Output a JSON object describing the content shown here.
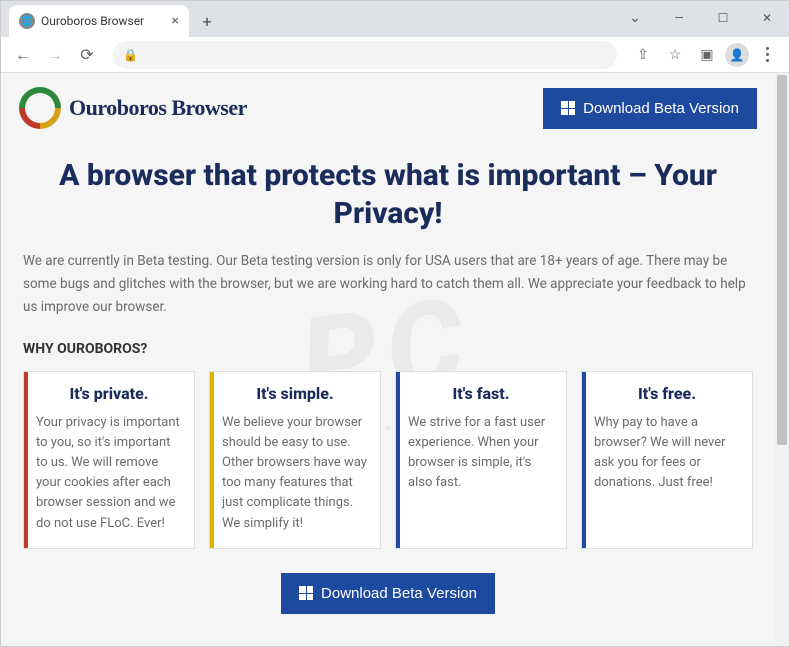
{
  "chrome": {
    "tab_title": "Ouroboros Browser",
    "tab_close": "×",
    "new_tab": "+",
    "win_chevron": "⌄",
    "win_minimize": "—",
    "win_maximize": "☐",
    "win_close": "✕",
    "nav_back": "←",
    "nav_forward": "→",
    "nav_reload": "⟳",
    "lock": "🔒",
    "share": "⇪",
    "star": "☆",
    "reader": "▣"
  },
  "header": {
    "brand": "Ouroboros Browser",
    "download_label": "Download Beta Version"
  },
  "hero": {
    "title": "A browser that protects what is important – Your Privacy!"
  },
  "subtext": "We are currently in Beta testing. Our Beta testing version is only for USA users that are 18+ years of age. There may be some bugs and glitches with the browser, but we are working hard to catch them all. We appreciate your feedback to help us improve our browser.",
  "why_label": "WHY OUROBOROS?",
  "cards": [
    {
      "title": "It's private.",
      "body": "Your privacy is important to you, so it's important to us. We will remove your cookies after each browser session and we do not use FLoC. Ever!",
      "accent": "red"
    },
    {
      "title": "It's simple.",
      "body": "We believe your browser should be easy to use. Other browsers have way too many features that just complicate things. We simplify it!",
      "accent": "yellow"
    },
    {
      "title": "It's fast.",
      "body": "We strive for a fast user experience. When your browser is simple, it's also fast.",
      "accent": "blue"
    },
    {
      "title": "It's free.",
      "body": "Why pay to have a browser? We will never ask you for fees or donations. Just free!",
      "accent": "blue"
    }
  ],
  "cta": {
    "download_label": "Download Beta Version"
  },
  "watermark": {
    "main": "PC",
    "sub": "risk.com"
  }
}
